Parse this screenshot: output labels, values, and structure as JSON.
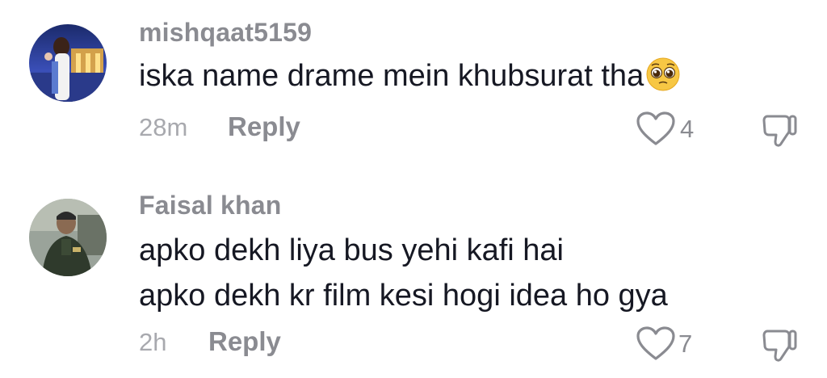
{
  "comments": [
    {
      "username": "mishqaat5159",
      "lines": [
        "iska name drame mein khubsurat tha"
      ],
      "emoji": "pleading-face-emoji",
      "time": "28m",
      "reply_label": "Reply",
      "likes": "4"
    },
    {
      "username": "Faisal khan",
      "lines": [
        "apko dekh liya bus yehi kafi hai",
        "apko dekh kr film kesi hogi idea ho gya"
      ],
      "time": "2h",
      "reply_label": "Reply",
      "likes": "7"
    }
  ],
  "icons": {
    "like": "heart-outline-icon",
    "dislike": "thumbs-down-outline-icon"
  },
  "colors": {
    "text": "#161823",
    "muted": "#8a8b91",
    "time": "#a8a9ae"
  }
}
